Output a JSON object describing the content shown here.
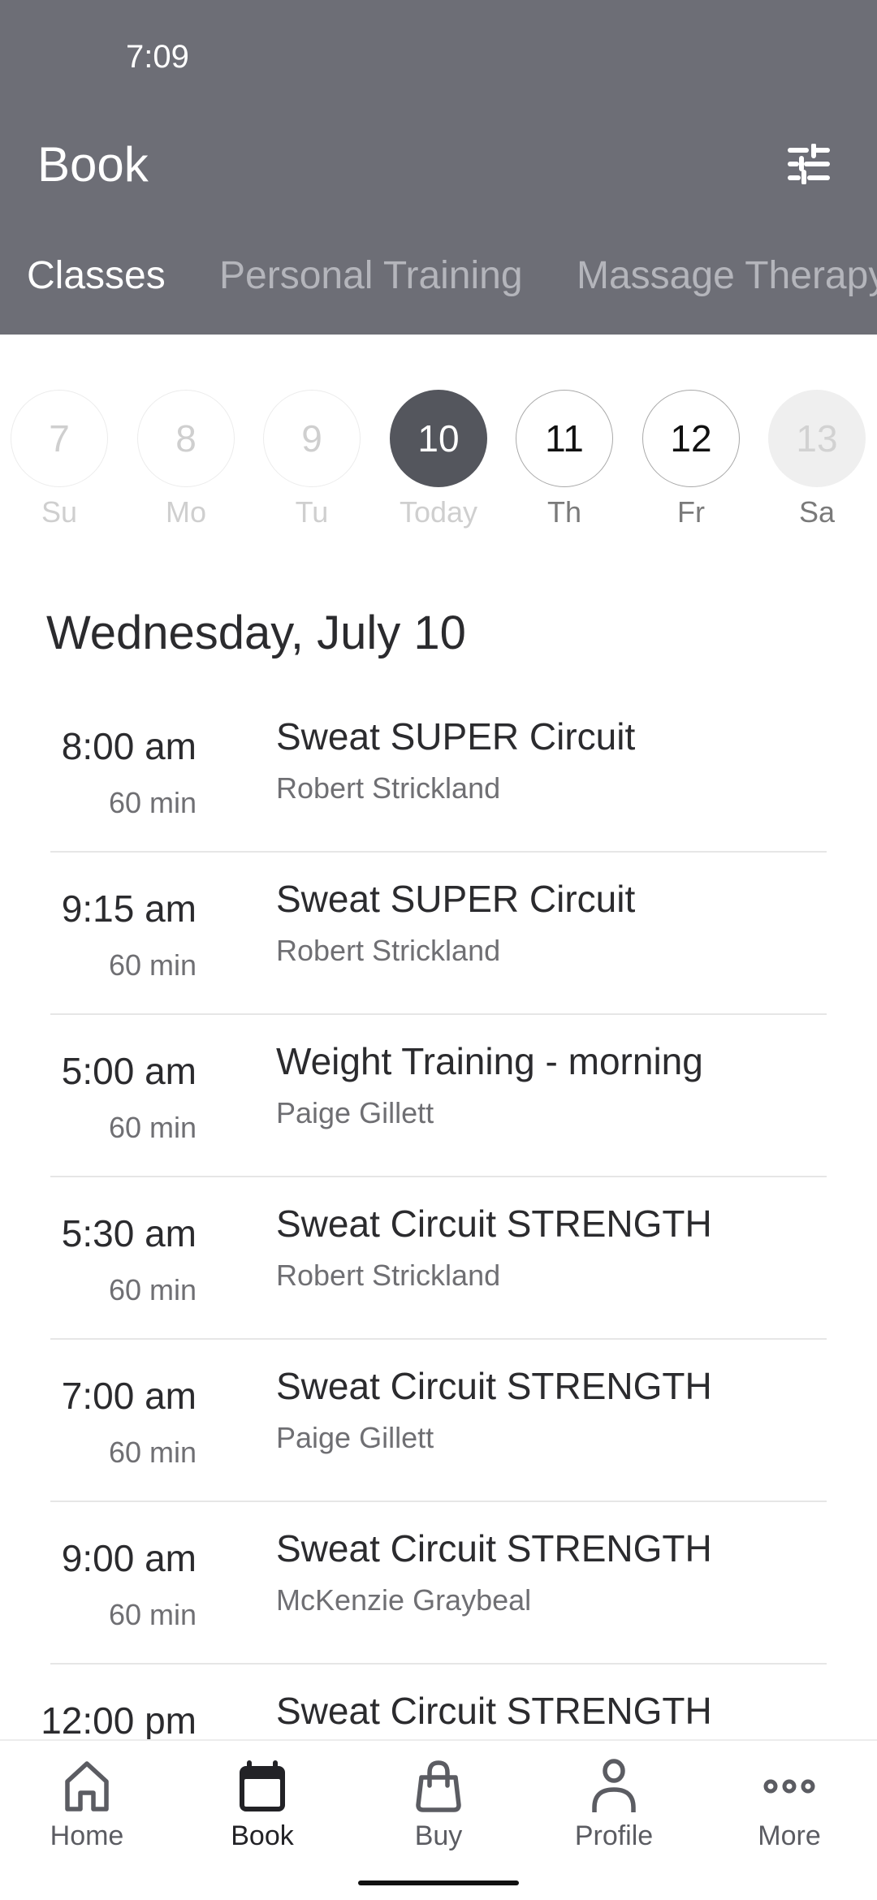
{
  "status_bar": {
    "time": "7:09"
  },
  "header": {
    "title": "Book",
    "filter_icon": "tune-sliders-icon"
  },
  "tabs": [
    {
      "label": "Classes",
      "active": true
    },
    {
      "label": "Personal Training",
      "active": false
    },
    {
      "label": "Massage Therapy",
      "active": false
    }
  ],
  "days": [
    {
      "number": "7",
      "label": "Su",
      "state": "past"
    },
    {
      "number": "8",
      "label": "Mo",
      "state": "past"
    },
    {
      "number": "9",
      "label": "Tu",
      "state": "past"
    },
    {
      "number": "10",
      "label": "Today",
      "state": "selected"
    },
    {
      "number": "11",
      "label": "Th",
      "state": "available"
    },
    {
      "number": "12",
      "label": "Fr",
      "state": "available"
    },
    {
      "number": "13",
      "label": "Sa",
      "state": "disabled"
    }
  ],
  "date_heading": "Wednesday, July 10",
  "classes": [
    {
      "time": "8:00 am",
      "duration": "60 min",
      "title": "Sweat SUPER Circuit",
      "instructor": "Robert Strickland"
    },
    {
      "time": "9:15 am",
      "duration": "60 min",
      "title": "Sweat SUPER Circuit",
      "instructor": "Robert Strickland"
    },
    {
      "time": "5:00 am",
      "duration": "60 min",
      "title": "Weight Training - morning",
      "instructor": "Paige Gillett"
    },
    {
      "time": "5:30 am",
      "duration": "60 min",
      "title": "Sweat Circuit STRENGTH",
      "instructor": "Robert Strickland"
    },
    {
      "time": "7:00 am",
      "duration": "60 min",
      "title": "Sweat Circuit STRENGTH",
      "instructor": "Paige Gillett"
    },
    {
      "time": "9:00 am",
      "duration": "60 min",
      "title": "Sweat Circuit STRENGTH",
      "instructor": "McKenzie Graybeal"
    },
    {
      "time": "12:00 pm",
      "duration": "",
      "title": "Sweat Circuit STRENGTH",
      "instructor": ""
    }
  ],
  "bottom_nav": [
    {
      "label": "Home",
      "icon": "home-icon",
      "active": false
    },
    {
      "label": "Book",
      "icon": "calendar-icon",
      "active": true
    },
    {
      "label": "Buy",
      "icon": "shopping-bag-icon",
      "active": false
    },
    {
      "label": "Profile",
      "icon": "person-icon",
      "active": false
    },
    {
      "label": "More",
      "icon": "more-dots-icon",
      "active": false
    }
  ],
  "colors": {
    "header_bg": "#6d6e76",
    "selected_day": "#54565d",
    "text_primary": "#2b2b2e",
    "text_secondary": "#6f6f73"
  }
}
